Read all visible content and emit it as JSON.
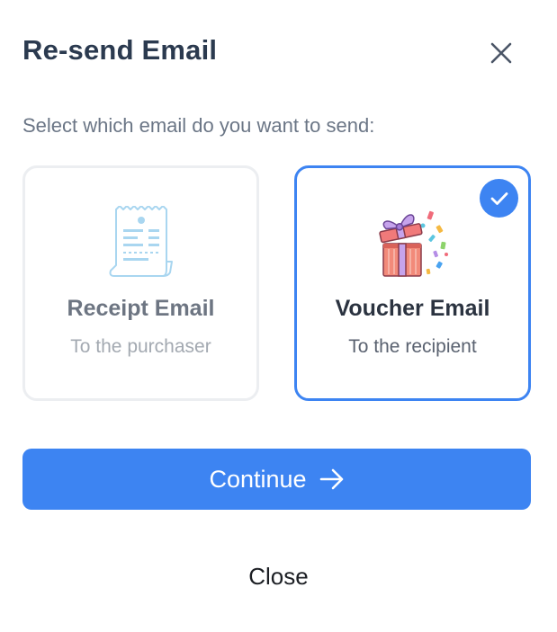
{
  "dialog": {
    "title": "Re-send Email",
    "subtitle": "Select which email do you want to send:"
  },
  "options": [
    {
      "label": "Receipt Email",
      "description": "To the purchaser",
      "selected": false,
      "icon": "receipt-icon"
    },
    {
      "label": "Voucher Email",
      "description": "To the recipient",
      "selected": true,
      "icon": "gift-box-icon"
    }
  ],
  "actions": {
    "continue_label": "Continue",
    "close_label": "Close"
  },
  "colors": {
    "accent": "#3d84f2",
    "title": "#2b3a4f",
    "border_inactive": "#eceef1"
  }
}
